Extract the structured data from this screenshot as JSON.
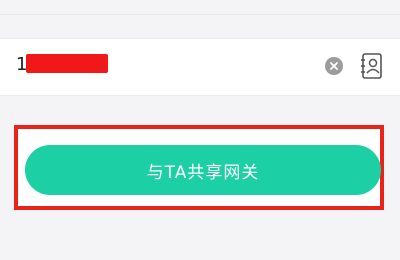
{
  "phone_input": {
    "value": "1        8",
    "clear_icon": "close-circle-icon",
    "contact_icon": "contact-book-icon"
  },
  "share_button": {
    "label": "与TA共享网关",
    "color": "#1ccfa4"
  },
  "colors": {
    "highlight": "#e8231a",
    "redaction": "#f01818"
  }
}
